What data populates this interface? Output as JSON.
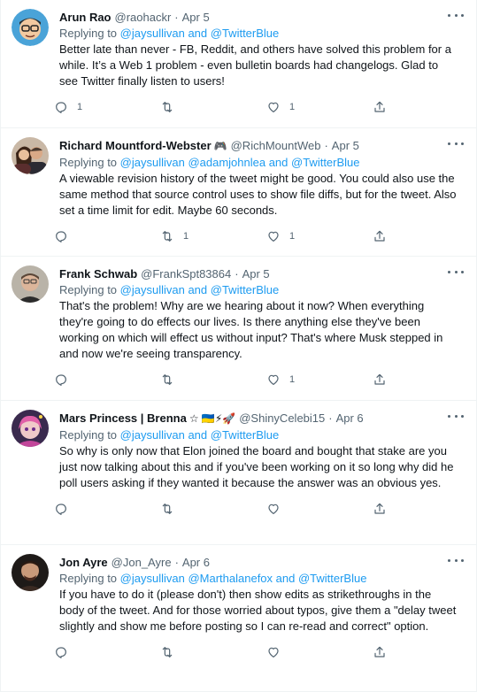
{
  "tweets": [
    {
      "name": "Arun Rao",
      "badge": "",
      "handle": "@raohackr",
      "date": "Apr 5",
      "replying_prefix": "Replying to",
      "mentions": "@jaysullivan and @TwitterBlue",
      "text": "Better late than never - FB, Reddit, and others have solved this problem for a while.  It’s a Web 1 problem - even bulletin boards had changelogs.  Glad to see Twitter finally listen to users!",
      "reply_count": "1",
      "retweet_count": "",
      "like_count": "1",
      "avatar_color": "#4aa3d8"
    },
    {
      "name": "Richard Mountford-Webster",
      "badge": "🎮",
      "handle": "@RichMountWeb",
      "date": "Apr 5",
      "replying_prefix": "Replying to",
      "mentions": "@jaysullivan @adamjohnlea and @TwitterBlue",
      "text": "A viewable revision history of the tweet might be good. You could also use the same method that source control uses to show file diffs, but for the tweet. Also set a time limit for edit. Maybe 60 seconds.",
      "reply_count": "",
      "retweet_count": "1",
      "like_count": "1",
      "avatar_color": "#8a6a5a"
    },
    {
      "name": "Frank Schwab",
      "badge": "",
      "handle": "@FrankSpt83864",
      "date": "Apr 5",
      "replying_prefix": "Replying to",
      "mentions": "@jaysullivan and @TwitterBlue",
      "text": "That's the problem! Why are we hearing about it now? When everything they're going to do effects our lives. Is there anything else they've been working on which will effect us without input? That's where Musk stepped in and now we're seeing transparency.",
      "reply_count": "",
      "retweet_count": "",
      "like_count": "1",
      "avatar_color": "#9a8a7a"
    },
    {
      "name": "Mars Princess | Brenna",
      "badge": "☆ 🇺🇦⚡🚀",
      "handle": "@ShinyCelebi15",
      "date": "Apr 6",
      "replying_prefix": "Replying to",
      "mentions": "@jaysullivan and @TwitterBlue",
      "text": "So why is only now that Elon joined the board and bought that stake are you just now talking about this and if you've been working on it so long why did he poll users asking if they wanted it because the answer was an obvious yes.",
      "reply_count": "",
      "retweet_count": "",
      "like_count": "",
      "avatar_color": "#b06aa8"
    },
    {
      "name": "Jon Ayre",
      "badge": "",
      "handle": "@Jon_Ayre",
      "date": "Apr 6",
      "replying_prefix": "Replying to",
      "mentions": "@jaysullivan @Marthalanefox and @TwitterBlue",
      "text": "If you have to do it (please don't) then show edits as strikethroughs in the body of the tweet. And for those worried about typos, give them a \"delay tweet slightly and show me before posting so I can re-read and correct\" option.",
      "reply_count": "",
      "retweet_count": "",
      "like_count": "",
      "avatar_color": "#5a4a3a"
    }
  ],
  "icons": [
    "more-icon",
    "reply-icon",
    "retweet-icon",
    "like-icon",
    "share-icon"
  ]
}
